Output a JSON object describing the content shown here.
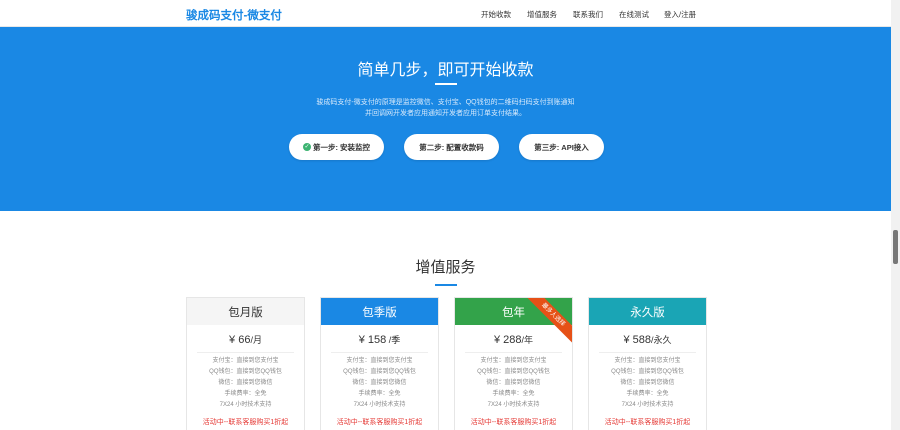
{
  "brand": "骏成码支付-微支付",
  "nav": [
    "开始收款",
    "增值服务",
    "联系我们",
    "在线测试",
    "登入/注册"
  ],
  "hero": {
    "title": "简单几步，即可开始收款",
    "desc_line1": "骏成码支付-微支付的原理是监控微信、支付宝、QQ钱包的二维码扫码支付到账通知",
    "desc_line2": "并回调网开发者应用通知开发者应用订单支付结果。",
    "steps": [
      "第一步: 安装监控",
      "第二步: 配置收款码",
      "第三步: API接入"
    ]
  },
  "section": {
    "title": "增值服务"
  },
  "plans": [
    {
      "name": "包月版",
      "price": "¥ 66",
      "unit": "/月",
      "header_color": "#f5f5f5",
      "header_text_color": "#333333",
      "features": [
        "支付宝：直接到您支付宝",
        "QQ钱包：直接到您QQ钱包",
        "微信：直接到您微信",
        "手续费率：全免",
        "7X24 小时技术支持"
      ],
      "promo": "活动中--联系客服购买1折起"
    },
    {
      "name": "包季版",
      "price": "¥ 158",
      "unit": " /季",
      "header_color": "#1a88e4",
      "header_text_color": "#ffffff",
      "features": [
        "支付宝：直接到您支付宝",
        "QQ钱包：直接到您QQ钱包",
        "微信：直接到您微信",
        "手续费率：全免",
        "7X24 小时技术支持"
      ],
      "promo": "活动中--联系客服购买1折起"
    },
    {
      "name": "包年",
      "price": "¥ 288",
      "unit": "/年",
      "header_color": "#33a34a",
      "header_text_color": "#ffffff",
      "ribbon": "最多人选择",
      "features": [
        "支付宝：直接到您支付宝",
        "QQ钱包：直接到您QQ钱包",
        "微信：直接到您微信",
        "手续费率：全免",
        "7X24 小时技术支持"
      ],
      "promo": "活动中--联系客服购买1折起"
    },
    {
      "name": "永久版",
      "price": "¥ 588",
      "unit": "/永久",
      "header_color": "#1aa5b5",
      "header_text_color": "#ffffff",
      "features": [
        "支付宝：直接到您支付宝",
        "QQ钱包：直接到您QQ钱包",
        "微信：直接到您微信",
        "手续费率：全免",
        "7X24 小时技术支持"
      ],
      "promo": "活动中--联系客服购买1折起"
    }
  ]
}
